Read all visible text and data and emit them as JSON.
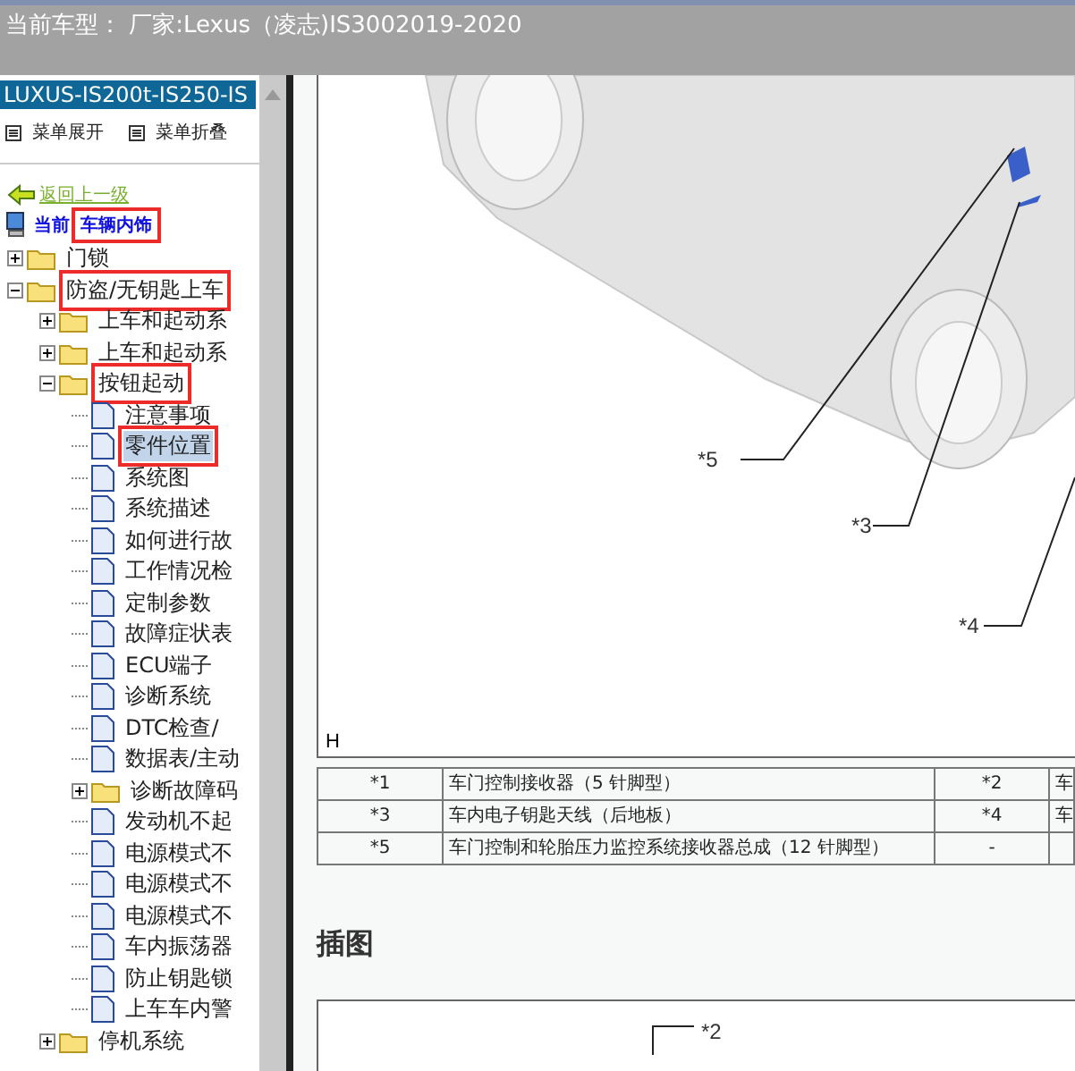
{
  "window": {
    "title": "当前车型： 厂家:Lexus（凌志)IS3002019-2020"
  },
  "sidebar": {
    "header": "LUXUS-IS200t-IS250-IS",
    "menu_buttons": [
      "菜单展开",
      "菜单折叠"
    ],
    "back_link": "返回上一级",
    "current_label": "当前",
    "current_value": "车辆内饰",
    "current_marked": true,
    "tree": [
      {
        "label": "门锁",
        "kind": "folder",
        "expanded": false,
        "selected": false,
        "marked": false
      },
      {
        "label": "防盗/无钥匙上车",
        "kind": "folder",
        "expanded": true,
        "selected": false,
        "marked": true,
        "children": [
          {
            "label": "上车和起动系",
            "kind": "folder",
            "expanded": false,
            "selected": false,
            "marked": false
          },
          {
            "label": "上车和起动系",
            "kind": "folder",
            "expanded": false,
            "selected": false,
            "marked": false
          },
          {
            "label": "按钮起动",
            "kind": "folder",
            "expanded": true,
            "selected": false,
            "marked": true,
            "children": [
              {
                "label": "注意事项",
                "kind": "page",
                "selected": false,
                "marked": false
              },
              {
                "label": "零件位置",
                "kind": "page",
                "selected": true,
                "marked": true
              },
              {
                "label": "系统图",
                "kind": "page",
                "selected": false,
                "marked": false
              },
              {
                "label": "系统描述",
                "kind": "page",
                "selected": false,
                "marked": false
              },
              {
                "label": "如何进行故",
                "kind": "page",
                "selected": false,
                "marked": false
              },
              {
                "label": "工作情况检",
                "kind": "page",
                "selected": false,
                "marked": false
              },
              {
                "label": "定制参数",
                "kind": "page",
                "selected": false,
                "marked": false
              },
              {
                "label": "故障症状表",
                "kind": "page",
                "selected": false,
                "marked": false
              },
              {
                "label": "ECU端子",
                "kind": "page",
                "selected": false,
                "marked": false
              },
              {
                "label": "诊断系统",
                "kind": "page",
                "selected": false,
                "marked": false
              },
              {
                "label": "DTC检查/",
                "kind": "page",
                "selected": false,
                "marked": false
              },
              {
                "label": "数据表/主动",
                "kind": "page",
                "selected": false,
                "marked": false
              },
              {
                "label": "诊断故障码",
                "kind": "folder",
                "expanded": false,
                "selected": false,
                "marked": false
              },
              {
                "label": "发动机不起",
                "kind": "page",
                "selected": false,
                "marked": false
              },
              {
                "label": "电源模式不",
                "kind": "page",
                "selected": false,
                "marked": false
              },
              {
                "label": "电源模式不",
                "kind": "page",
                "selected": false,
                "marked": false
              },
              {
                "label": "电源模式不",
                "kind": "page",
                "selected": false,
                "marked": false
              },
              {
                "label": "车内振荡器",
                "kind": "page",
                "selected": false,
                "marked": false
              },
              {
                "label": "防止钥匙锁",
                "kind": "page",
                "selected": false,
                "marked": false
              },
              {
                "label": "上车车内警",
                "kind": "page",
                "selected": false,
                "marked": false
              }
            ]
          },
          {
            "label": "停机系统",
            "kind": "folder",
            "expanded": false,
            "selected": false,
            "marked": false
          }
        ]
      }
    ]
  },
  "figure": {
    "corner_label": "H",
    "callouts": [
      "*5",
      "*3",
      "*4"
    ]
  },
  "table": {
    "rows": [
      [
        "*1",
        "车门控制接收器（5 针脚型）",
        "*2",
        "车"
      ],
      [
        "*3",
        "车内电子钥匙天线（后地板）",
        "*4",
        "车"
      ],
      [
        "*5",
        "车门控制和轮胎压力监控系统接收器总成（12 针脚型）",
        "-",
        ""
      ]
    ]
  },
  "section_heading": "插图",
  "figure_2": {
    "callouts": [
      "*2"
    ]
  }
}
